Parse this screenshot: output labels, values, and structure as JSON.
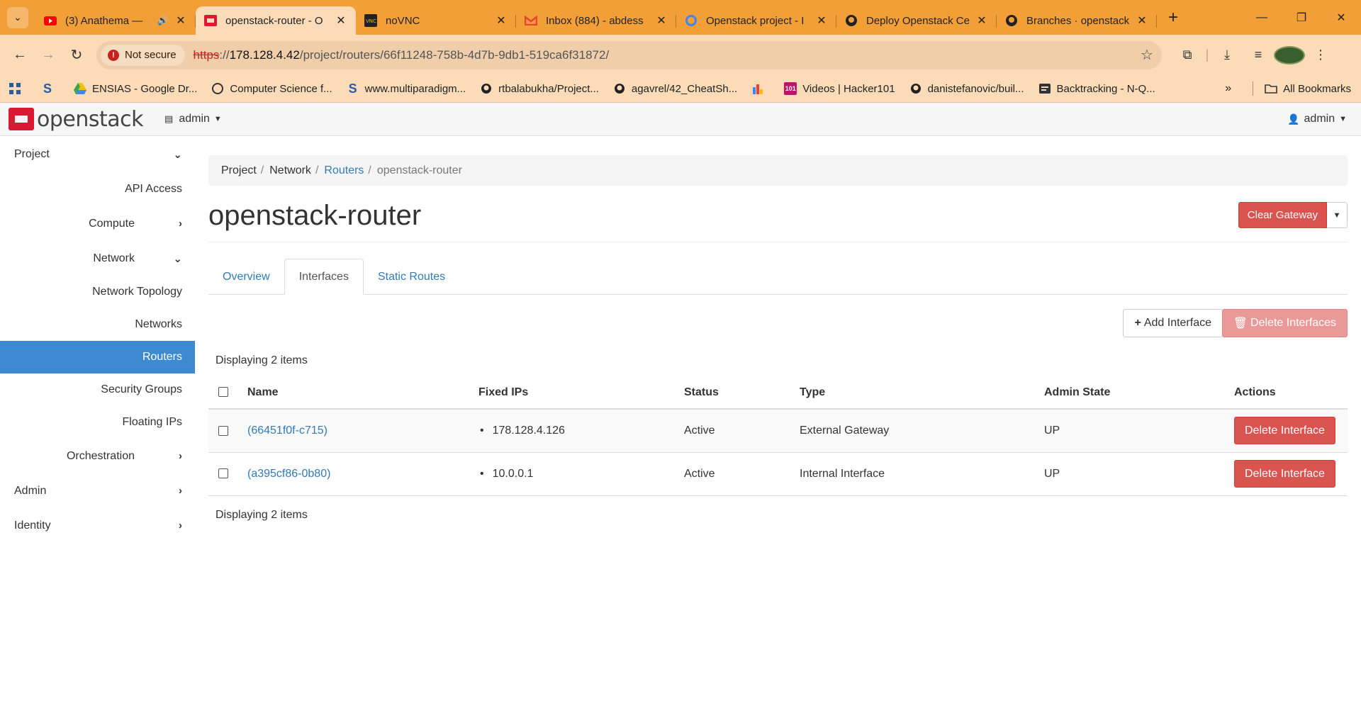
{
  "browser": {
    "tabs": [
      {
        "title": "(3) Anathema —",
        "extra": "🔊",
        "icon": "youtube-icon",
        "active": false
      },
      {
        "title": "openstack-router - O",
        "icon": "openstack-icon",
        "active": true
      },
      {
        "title": "noVNC",
        "icon": "vnc-icon",
        "active": false
      },
      {
        "title": "Inbox (884) - abdess",
        "icon": "gmail-icon",
        "active": false
      },
      {
        "title": "Openstack project - I",
        "icon": "loop-icon",
        "active": false
      },
      {
        "title": "Deploy Openstack Ce",
        "icon": "github-icon",
        "active": false
      },
      {
        "title": "Branches · openstack",
        "icon": "github-icon",
        "active": false
      }
    ],
    "security_label": "Not secure",
    "url": {
      "scheme": "https",
      "rest_sep": "://",
      "host": "178.128.4.42",
      "path": "/project/routers/66f11248-758b-4d7b-9db1-519ca6f31872/"
    },
    "bookmarks": [
      {
        "label": "",
        "icon": "apps-grid-icon"
      },
      {
        "label": "",
        "icon": "s-logo-icon"
      },
      {
        "label": "ENSIAS - Google Dr...",
        "icon": "drive-icon"
      },
      {
        "label": "Computer Science f...",
        "icon": "globe-icon"
      },
      {
        "label": "www.multiparadigm...",
        "icon": "s-logo-icon"
      },
      {
        "label": "rtbalabukha/Project...",
        "icon": "github-icon"
      },
      {
        "label": "agavrel/42_CheatSh...",
        "icon": "github-icon"
      },
      {
        "label": "",
        "icon": "chart-icon"
      },
      {
        "label": "Videos | Hacker101",
        "icon": "h101-icon"
      },
      {
        "label": "danistefanovic/buil...",
        "icon": "github-icon"
      },
      {
        "label": "Backtracking - N-Q...",
        "icon": "page-icon"
      }
    ],
    "all_bookmarks": "All Bookmarks"
  },
  "app": {
    "logo_text": "openstack",
    "project_selector": "admin",
    "user_menu": "admin",
    "sidebar": {
      "project": "Project",
      "api_access": "API Access",
      "compute": "Compute",
      "network": "Network",
      "network_topology": "Network Topology",
      "networks": "Networks",
      "routers": "Routers",
      "security_groups": "Security Groups",
      "floating_ips": "Floating IPs",
      "orchestration": "Orchestration",
      "admin": "Admin",
      "identity": "Identity"
    },
    "breadcrumb": {
      "project": "Project",
      "network": "Network",
      "routers": "Routers",
      "current": "openstack-router"
    },
    "page_title": "openstack-router",
    "clear_gateway": "Clear Gateway",
    "tabs": {
      "overview": "Overview",
      "interfaces": "Interfaces",
      "static_routes": "Static Routes"
    },
    "add_interface": "Add Interface",
    "delete_interfaces": "Delete Interfaces",
    "count_top": "Displaying 2 items",
    "count_bottom": "Displaying 2 items",
    "table": {
      "headers": {
        "name": "Name",
        "fixed_ips": "Fixed IPs",
        "status": "Status",
        "type": "Type",
        "admin_state": "Admin State",
        "actions": "Actions"
      },
      "rows": [
        {
          "name": "(66451f0f-c715)",
          "ip": "178.128.4.126",
          "status": "Active",
          "type": "External Gateway",
          "admin_state": "UP",
          "action": "Delete Interface"
        },
        {
          "name": "(a395cf86-0b80)",
          "ip": "10.0.0.1",
          "status": "Active",
          "type": "Internal Interface",
          "admin_state": "UP",
          "action": "Delete Interface"
        }
      ]
    }
  }
}
